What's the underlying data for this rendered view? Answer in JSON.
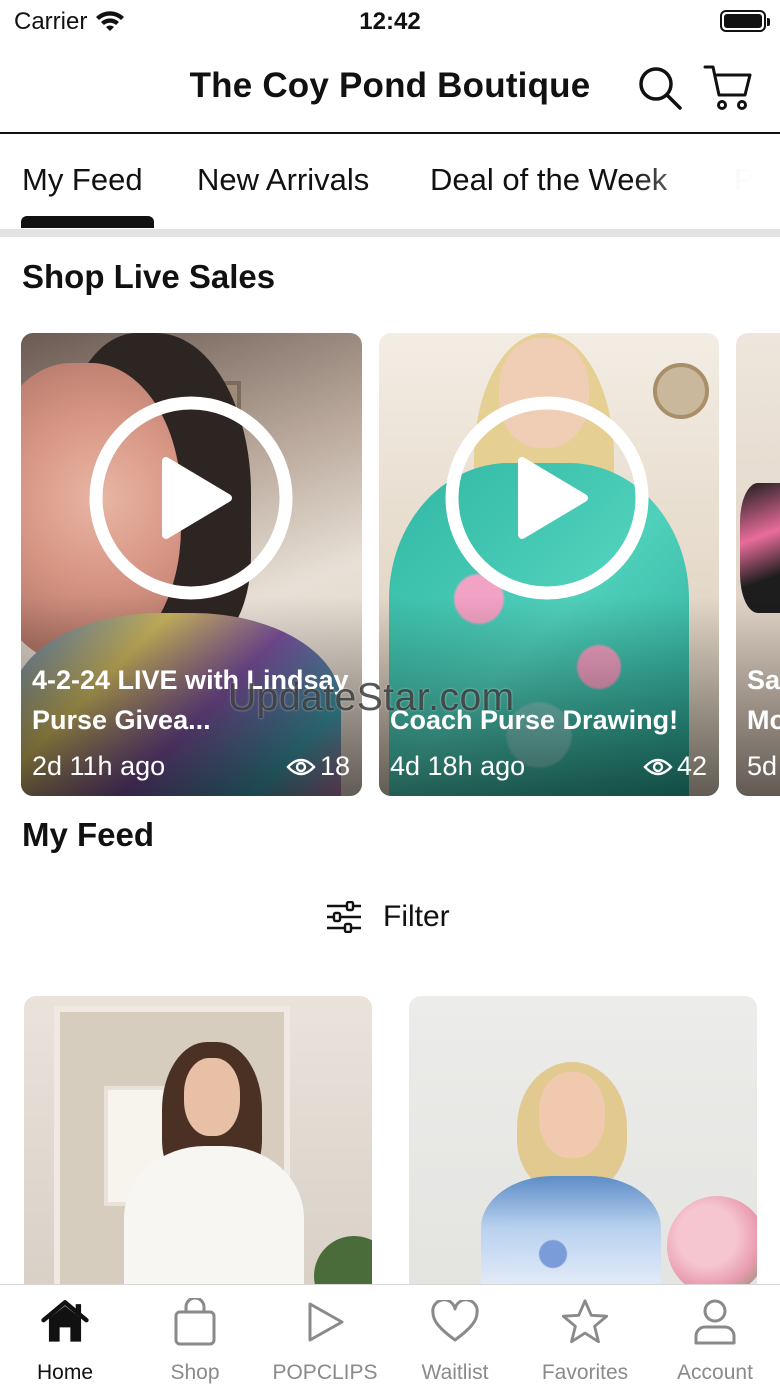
{
  "status_bar": {
    "carrier": "Carrier",
    "time": "12:42"
  },
  "header": {
    "title": "The Coy Pond Boutique",
    "icons": [
      "search-icon",
      "cart-icon"
    ]
  },
  "tabs": [
    {
      "label": "My Feed",
      "active": true
    },
    {
      "label": "New Arrivals",
      "active": false
    },
    {
      "label": "Deal of the Week",
      "active": false
    },
    {
      "label": "P",
      "active": false
    }
  ],
  "live_sales": {
    "title": "Shop Live Sales",
    "cards": [
      {
        "caption": "4-2-24 LIVE with Lindsay Purse Givea...",
        "time": "2d 11h ago",
        "views": "18"
      },
      {
        "caption": "Coach Purse Drawing!",
        "time": "4d 18h ago",
        "views": "42"
      },
      {
        "caption": "Sa Mo",
        "time": "5d",
        "views": ""
      }
    ]
  },
  "watermark": "UpdateStar.com",
  "feed": {
    "title": "My Feed",
    "filter_label": "Filter"
  },
  "bottom_nav": [
    {
      "label": "Home",
      "icon": "home-icon",
      "active": true
    },
    {
      "label": "Shop",
      "icon": "shopping-bag-icon",
      "active": false
    },
    {
      "label": "POPCLIPS",
      "icon": "play-icon",
      "active": false
    },
    {
      "label": "Waitlist",
      "icon": "heart-icon",
      "active": false
    },
    {
      "label": "Favorites",
      "icon": "star-icon",
      "active": false
    },
    {
      "label": "Account",
      "icon": "user-icon",
      "active": false
    }
  ],
  "colors": {
    "text": "#111111",
    "inactive": "#8a8a8a",
    "divider": "#e3e3e3"
  }
}
